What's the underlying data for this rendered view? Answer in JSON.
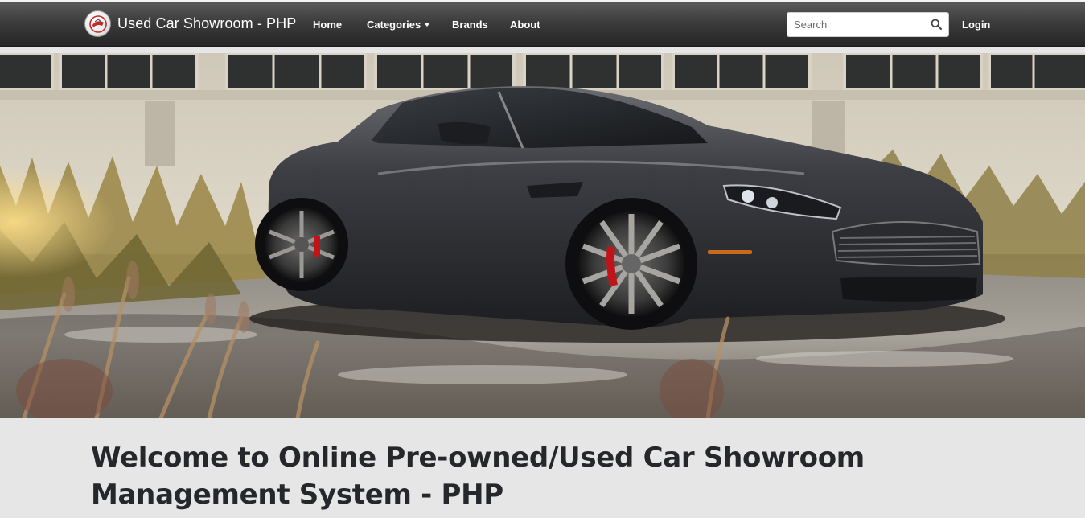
{
  "navbar": {
    "brand_name": "Used Car Showroom - PHP",
    "links": {
      "home": "Home",
      "categories": "Categories",
      "brands": "Brands",
      "about": "About"
    },
    "search": {
      "placeholder": "Search",
      "value": ""
    },
    "login": "Login",
    "colors": {
      "bar": "#333333",
      "text": "#ffffff"
    },
    "icons": {
      "logo": "brand-logo-icon",
      "search": "search-icon",
      "dropdown": "caret-down-icon"
    }
  },
  "hero": {
    "image": "sports-car-photo",
    "colors": {
      "car_body": "#3a3b3f",
      "brake_caliper": "#c0141a",
      "wall": "#d8d2c4"
    }
  },
  "main": {
    "welcome_heading": "Welcome to Online Pre-owned/Used Car Showroom Management System - PHP"
  }
}
